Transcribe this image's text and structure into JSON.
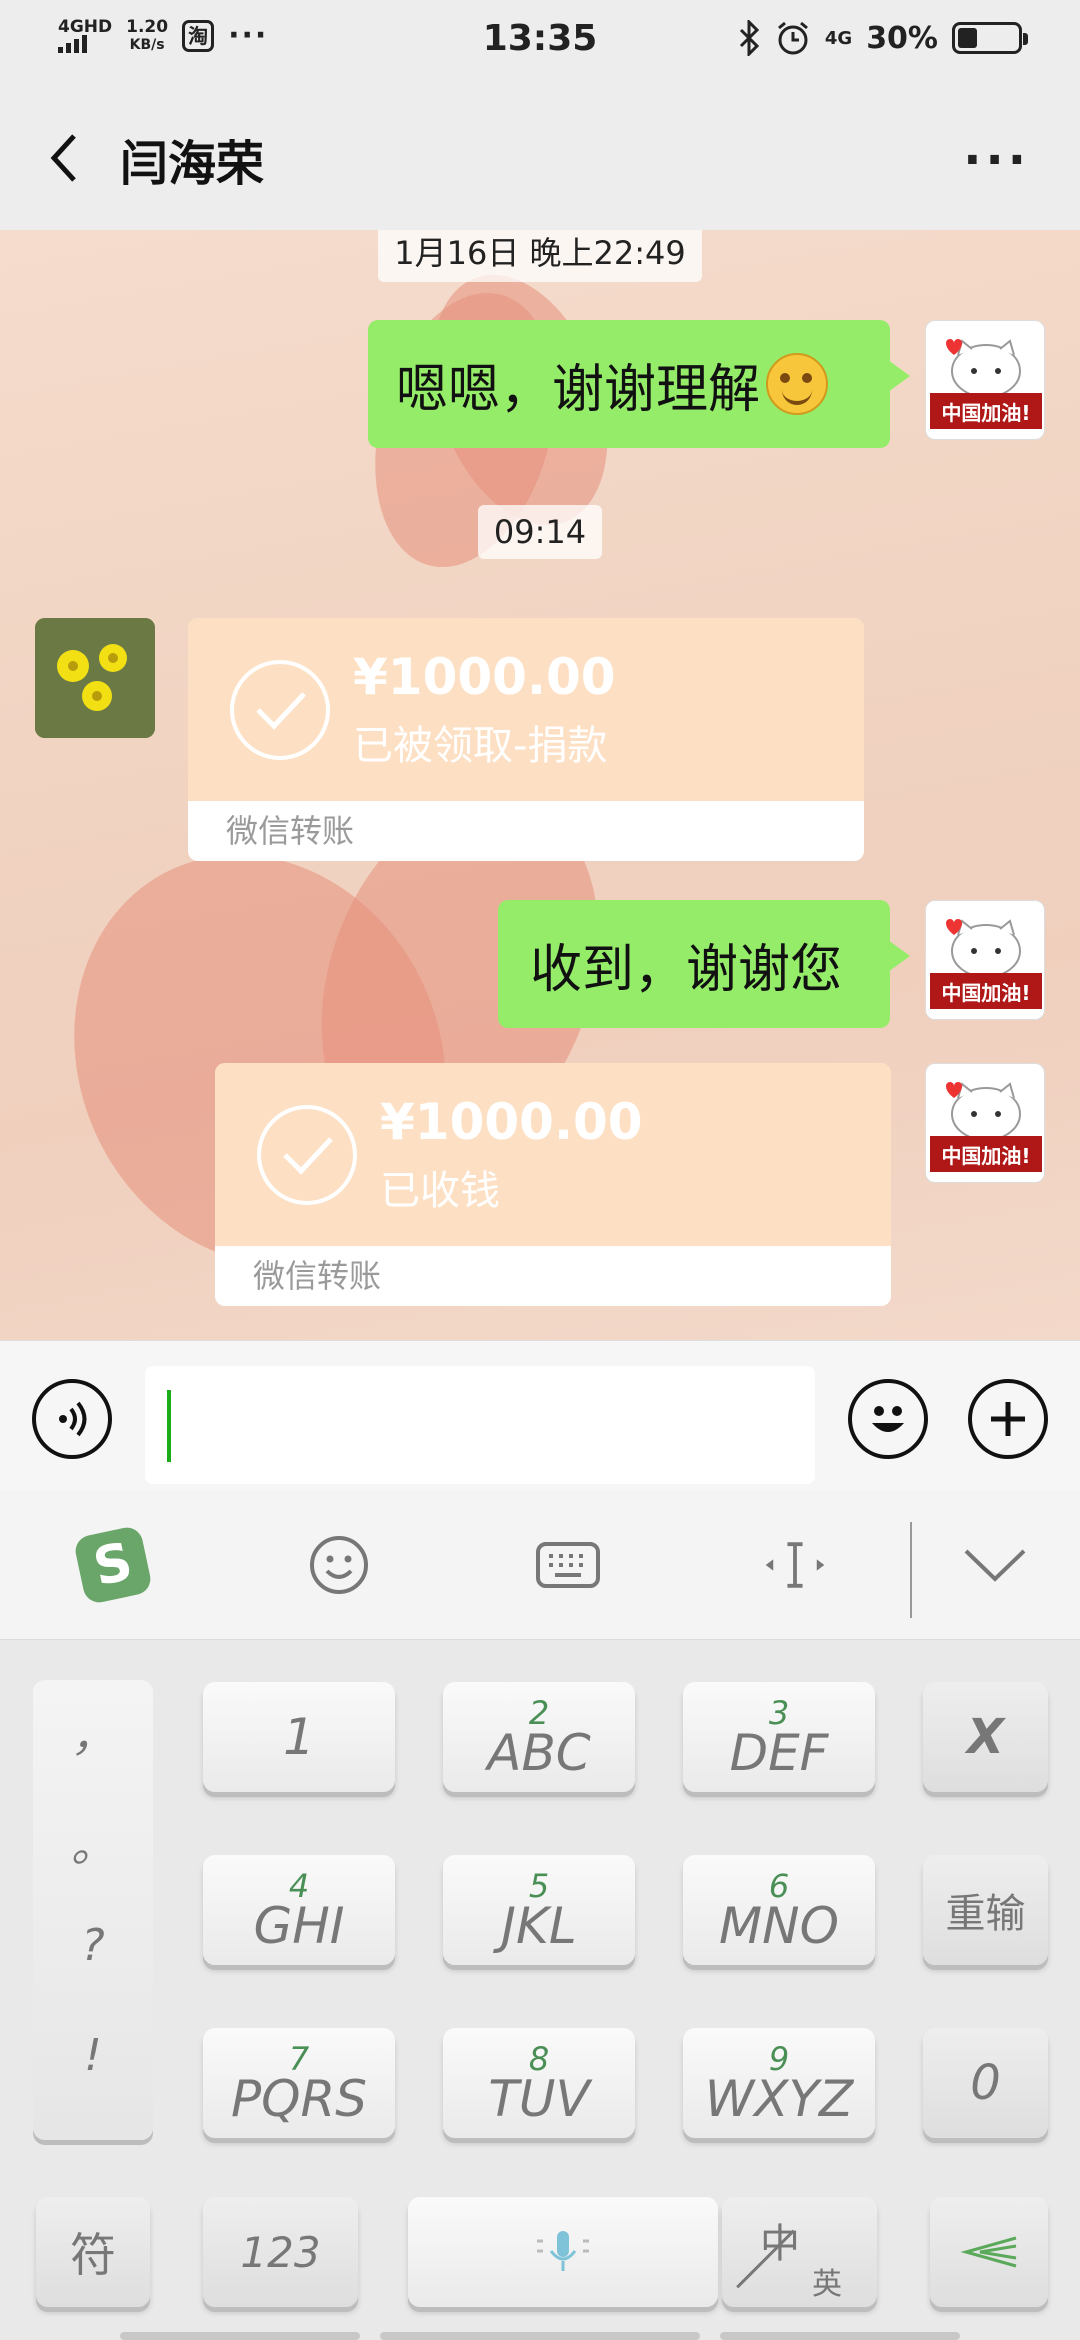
{
  "status_bar": {
    "network": "4GHD",
    "speed_value": "1.20",
    "speed_unit": "KB/s",
    "app_icon_label": "淘",
    "more_dots": "···",
    "time": "13:35",
    "right_network": "4G",
    "battery_percent": "30%",
    "battery_level": 0.3
  },
  "header": {
    "title": "闫海荣",
    "more": "···"
  },
  "chat": {
    "timestamp_1": "1月16日 晚上22:49",
    "message_1": "嗯嗯，谢谢理解",
    "timestamp_2": "09:14",
    "transfer_1": {
      "amount": "¥1000.00",
      "note": "已被领取-捐款",
      "label": "微信转账"
    },
    "message_2": "收到，谢谢您",
    "transfer_2": {
      "amount": "¥1000.00",
      "note": "已收钱",
      "label": "微信转账"
    },
    "cat_avatar_text": "中国加油!"
  },
  "keyboard": {
    "side_keys": [
      "，",
      "。",
      "?",
      "!"
    ],
    "keys": [
      {
        "num": "",
        "letters": "1"
      },
      {
        "num": "2",
        "letters": "ABC"
      },
      {
        "num": "3",
        "letters": "DEF"
      },
      {
        "num": "4",
        "letters": "GHI"
      },
      {
        "num": "5",
        "letters": "JKL"
      },
      {
        "num": "6",
        "letters": "MNO"
      },
      {
        "num": "7",
        "letters": "PQRS"
      },
      {
        "num": "8",
        "letters": "TUV"
      },
      {
        "num": "9",
        "letters": "WXYZ"
      }
    ],
    "delete_key": "X",
    "retype_key": "重输",
    "zero_key": "0",
    "symbol_key": "符",
    "num_key": "123",
    "lang_key_top": "中",
    "lang_key_bottom": "英",
    "sogou_logo": "S"
  },
  "colors": {
    "bubble_green": "#95ec69",
    "transfer_orange": "#fde0c4",
    "caret_green": "#1aad19"
  }
}
